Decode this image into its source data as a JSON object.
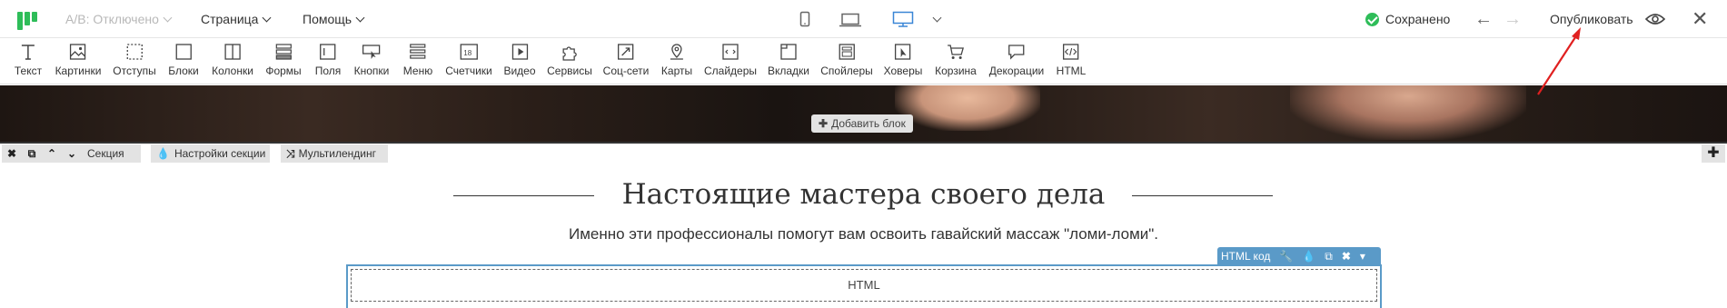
{
  "header": {
    "ab_label": "A/B: Отключено",
    "page_menu": "Страница",
    "help_menu": "Помощь",
    "saved_status": "Сохранено",
    "publish_label": "Опубликовать",
    "colors": {
      "brand": "#2ebd59",
      "active_device": "#3a86d6",
      "accent": "#5a9ac8"
    }
  },
  "toolbar": {
    "items": [
      {
        "label": "Текст",
        "icon": "text-icon"
      },
      {
        "label": "Картинки",
        "icon": "image-icon"
      },
      {
        "label": "Отступы",
        "icon": "spacing-icon"
      },
      {
        "label": "Блоки",
        "icon": "block-icon"
      },
      {
        "label": "Колонки",
        "icon": "columns-icon"
      },
      {
        "label": "Формы",
        "icon": "form-icon"
      },
      {
        "label": "Поля",
        "icon": "field-icon"
      },
      {
        "label": "Кнопки",
        "icon": "button-icon"
      },
      {
        "label": "Меню",
        "icon": "menu-icon"
      },
      {
        "label": "Счетчики",
        "icon": "counter-icon"
      },
      {
        "label": "Видео",
        "icon": "video-icon"
      },
      {
        "label": "Сервисы",
        "icon": "puzzle-icon"
      },
      {
        "label": "Соц-сети",
        "icon": "share-icon"
      },
      {
        "label": "Карты",
        "icon": "map-pin-icon"
      },
      {
        "label": "Слайдеры",
        "icon": "slider-icon"
      },
      {
        "label": "Вкладки",
        "icon": "tabs-icon"
      },
      {
        "label": "Спойлеры",
        "icon": "spoiler-icon"
      },
      {
        "label": "Ховеры",
        "icon": "hover-icon"
      },
      {
        "label": "Корзина",
        "icon": "cart-icon"
      },
      {
        "label": "Декорации",
        "icon": "decor-icon"
      },
      {
        "label": "HTML",
        "icon": "code-icon"
      }
    ]
  },
  "hero": {
    "add_block_label": "Добавить блок"
  },
  "section_bar": {
    "section_label": "Секция",
    "settings_label": "Настройки секции",
    "multilanding_label": "Мультилендинг"
  },
  "content": {
    "title": "Настоящие мастера своего дела",
    "subtitle": "Именно эти профессионалы помогут вам освоить гавайский массаж \"ломи-ломи\".",
    "html_widget_label": "HTML код",
    "html_placeholder": "HTML"
  }
}
